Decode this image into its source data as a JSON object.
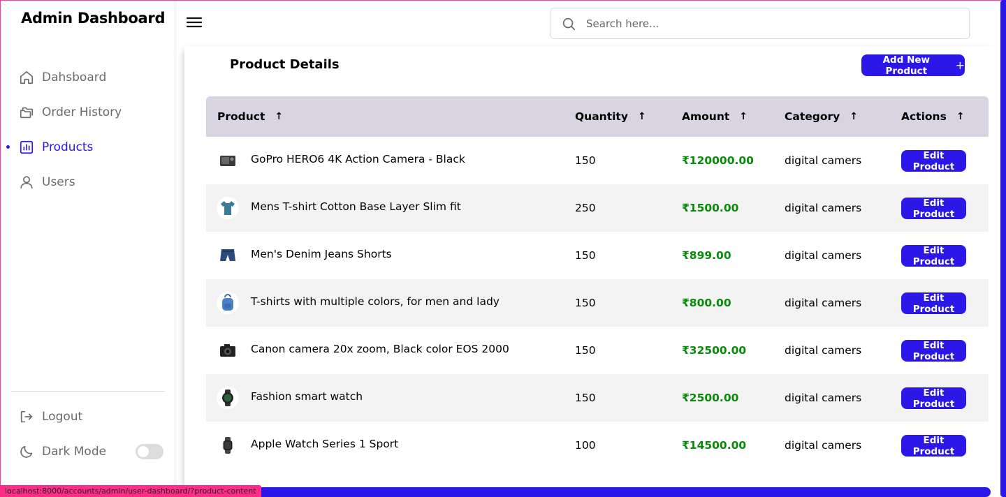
{
  "sidebar": {
    "brand": "Admin Dashboard",
    "items": [
      {
        "label": "Dahsboard",
        "icon": "home-icon"
      },
      {
        "label": "Order History",
        "icon": "folder-icon"
      },
      {
        "label": "Products",
        "icon": "chart-icon",
        "active": true
      },
      {
        "label": "Users",
        "icon": "user-icon"
      }
    ],
    "bottom": [
      {
        "label": "Logout",
        "icon": "logout-icon"
      },
      {
        "label": "Dark Mode",
        "icon": "moon-icon"
      }
    ]
  },
  "search": {
    "placeholder": "Search here..."
  },
  "main": {
    "title": "Product Details",
    "add_button": "Add New Product",
    "add_icon": "+"
  },
  "table": {
    "headers": [
      "Product",
      "Quantity",
      "Amount",
      "Category",
      "Actions"
    ],
    "sort_arrow": "↑",
    "rows": [
      {
        "name": "GoPro HERO6 4K Action Camera - Black",
        "quantity": "150",
        "amount": "₹120000.00",
        "category": "digital camers",
        "action": "Edit Product",
        "thumb": "camera-icon"
      },
      {
        "name": "Mens T-shirt Cotton Base Layer Slim fit",
        "quantity": "250",
        "amount": "₹1500.00",
        "category": "digital camers",
        "action": "Edit Product",
        "thumb": "tshirt-icon"
      },
      {
        "name": "Men's Denim Jeans Shorts",
        "quantity": "150",
        "amount": "₹899.00",
        "category": "digital camers",
        "action": "Edit Product",
        "thumb": "shorts-icon"
      },
      {
        "name": "T-shirts with multiple colors, for men and lady",
        "quantity": "150",
        "amount": "₹800.00",
        "category": "digital camers",
        "action": "Edit Product",
        "thumb": "backpack-icon"
      },
      {
        "name": "Canon camera 20x zoom, Black color EOS 2000",
        "quantity": "150",
        "amount": "₹32500.00",
        "category": "digital camers",
        "action": "Edit Product",
        "thumb": "dslr-icon"
      },
      {
        "name": "Fashion smart watch",
        "quantity": "150",
        "amount": "₹2500.00",
        "category": "digital camers",
        "action": "Edit Product",
        "thumb": "round-watch-icon"
      },
      {
        "name": "Apple Watch Series 1 Sport",
        "quantity": "100",
        "amount": "₹14500.00",
        "category": "digital camers",
        "action": "Edit Product",
        "thumb": "apple-watch-icon"
      }
    ]
  },
  "status_url": "localhost:8000/accounts/admin/user-dashboard/?product-content",
  "colors": {
    "accent": "#2a17e8",
    "amount": "#0a8a0a",
    "header_bg": "#d9d4e2",
    "alt_row": "#f3f3f3"
  }
}
